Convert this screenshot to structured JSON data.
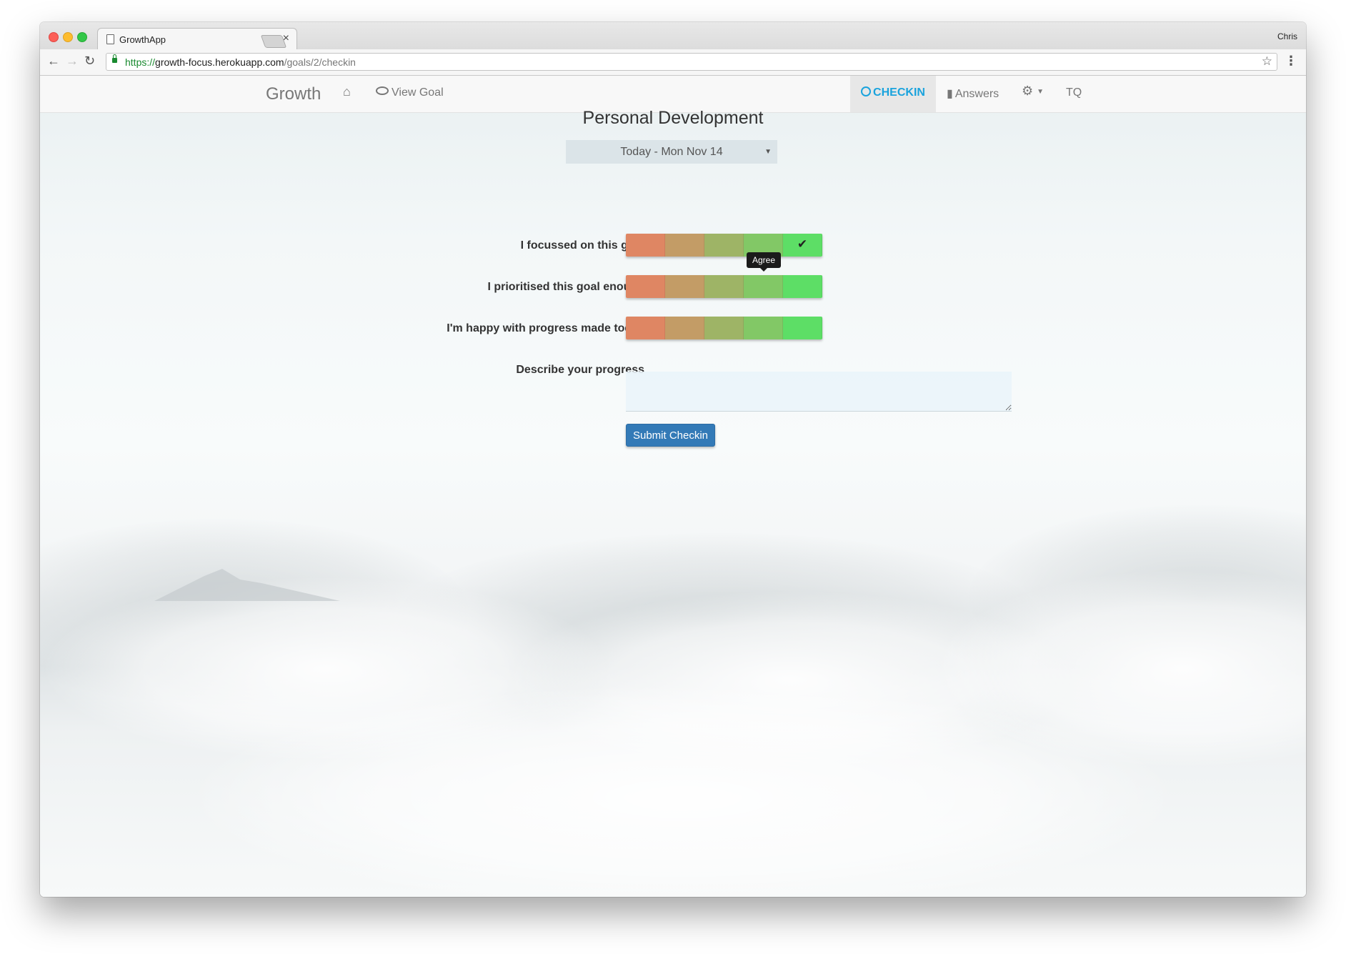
{
  "browser": {
    "tab_title": "GrowthApp",
    "profile_name": "Chris",
    "url_scheme": "https://",
    "url_host": "growth-focus.herokuapp.com",
    "url_path": "/goals/2/checkin"
  },
  "navbar": {
    "brand": "Growth",
    "view_goal": "View Goal",
    "checkin": "CHECKIN",
    "answers": "Answers",
    "tq": "TQ"
  },
  "form": {
    "goal_title": "Personal Development",
    "date_selected": "Today - Mon Nov 14",
    "questions": [
      {
        "label": "I focussed on this goal",
        "selected": 5
      },
      {
        "label": "I prioritised this goal enough",
        "selected": null
      },
      {
        "label": "I'm happy with progress made today",
        "selected": null
      }
    ],
    "scale_max": 5,
    "tooltip": "Agree",
    "describe_label": "Describe your progress",
    "textarea_value": "",
    "submit_label": "Submit Checkin"
  },
  "colors": {
    "accent": "#1aa3dd",
    "button": "#337ab7",
    "scale": [
      "#df8663",
      "#c39c66",
      "#9eb466",
      "#82c866",
      "#5dde66"
    ]
  },
  "icons": [
    "page-icon",
    "close-icon",
    "back-icon",
    "forward-icon",
    "reload-icon",
    "lock-icon",
    "star-icon",
    "menu-icon",
    "home-icon",
    "eye-icon",
    "clock-icon",
    "bar-chart-icon",
    "gear-icon",
    "check-icon"
  ]
}
